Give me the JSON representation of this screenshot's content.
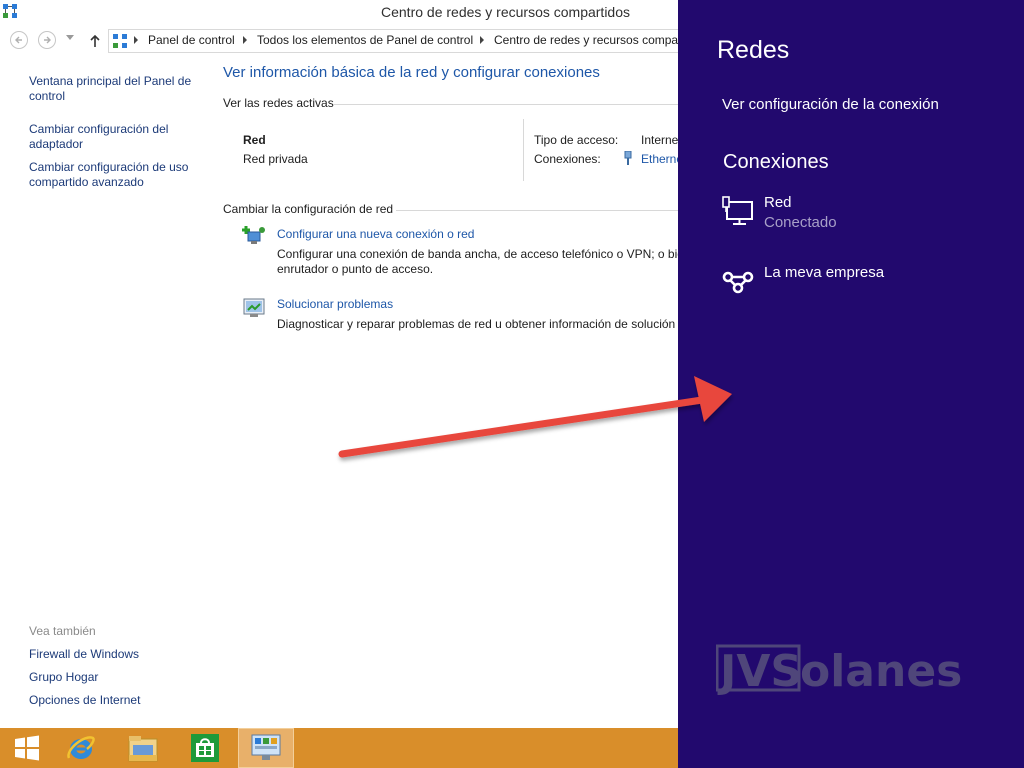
{
  "window": {
    "title": "Centro de redes y recursos compartidos"
  },
  "nav": {
    "breadcrumbs": [
      "Panel de control",
      "Todos los elementos de Panel de control",
      "Centro de redes y recursos compar"
    ]
  },
  "sidebar": {
    "links": [
      "Ventana principal del Panel de control",
      "Cambiar configuración del adaptador",
      "Cambiar configuración de uso compartido avanzado"
    ],
    "see_also_label": "Vea también",
    "see_also": [
      "Firewall de Windows",
      "Grupo Hogar",
      "Opciones de Internet"
    ]
  },
  "main": {
    "title": "Ver información básica de la red y configurar conexiones",
    "active_networks_label": "Ver las redes activas",
    "network": {
      "name": "Red",
      "profile": "Red privada",
      "access_type_label": "Tipo de acceso:",
      "access_type_value": "Interne",
      "connections_label": "Conexiones:",
      "connections_value": "Ethernet"
    },
    "change_settings_label": "Cambiar la configuración de red",
    "tasks": [
      {
        "icon": "new-connection-icon",
        "link": "Configurar una nueva conexión o red",
        "desc": "Configurar una conexión de banda ancha, de acceso telefónico o VPN; o bie enrutador o punto de acceso."
      },
      {
        "icon": "troubleshoot-icon",
        "link": "Solucionar problemas",
        "desc": "Diagnosticar y reparar problemas de red u obtener información de solución d"
      }
    ]
  },
  "charm": {
    "title": "Redes",
    "view_config": "Ver configuración de la conexión",
    "connections_heading": "Conexiones",
    "items": [
      {
        "icon": "wired-network-icon",
        "name": "Red",
        "status": "Conectado"
      },
      {
        "icon": "vpn-icon",
        "name": "La meva empresa",
        "status": ""
      }
    ],
    "watermark": "JVSolanes"
  },
  "taskbar": {
    "items": [
      "start-icon",
      "internet-explorer-icon",
      "file-explorer-icon",
      "store-icon",
      "control-panel-icon"
    ]
  },
  "colors": {
    "charm_bg": "#22096e",
    "taskbar_bg": "#d98e2a",
    "link": "#1e57a8",
    "arrow": "#e8473e"
  }
}
